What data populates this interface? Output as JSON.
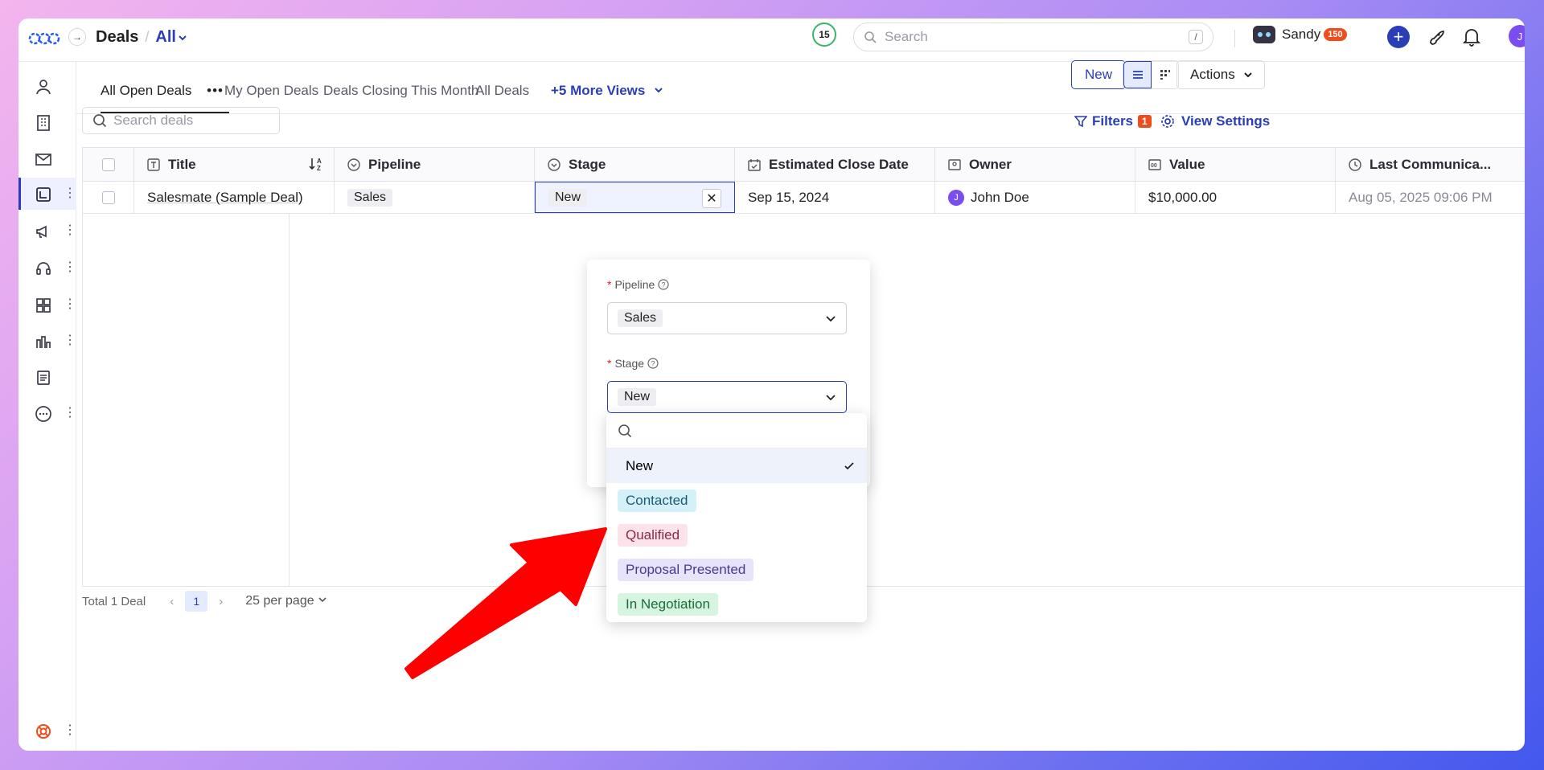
{
  "header": {
    "breadcrumb_current": "Deals",
    "view_name": "All",
    "notification_count": "15",
    "search_placeholder": "Search",
    "search_shortcut": "/",
    "user_name": "Sandy",
    "user_points": "150",
    "avatar_initial": "J"
  },
  "tabs": [
    {
      "label": "All Open Deals"
    },
    {
      "label": "My Open Deals"
    },
    {
      "label": "Deals Closing This Month"
    },
    {
      "label": "All Deals"
    },
    {
      "label": "+5 More Views"
    }
  ],
  "toolbar": {
    "new_label": "New",
    "actions_label": "Actions",
    "search_placeholder": "Search deals",
    "filters_label": "Filters",
    "filters_count": "1",
    "view_settings_label": "View Settings"
  },
  "table": {
    "columns": [
      "Title",
      "Pipeline",
      "Stage",
      "Estimated Close Date",
      "Owner",
      "Value",
      "Last Communica..."
    ],
    "rows": [
      {
        "title": "Salesmate (Sample Deal)",
        "pipeline": "Sales",
        "stage": "New",
        "close_date": "Sep 15, 2024",
        "owner": "John Doe",
        "owner_initial": "J",
        "value": "$10,000.00",
        "last_comm": "Aug 05, 2025 09:06 PM"
      }
    ]
  },
  "footer": {
    "total": "Total 1 Deal",
    "page": "1",
    "per_page": "25 per page"
  },
  "popover": {
    "pipeline_label": "Pipeline",
    "pipeline_value": "Sales",
    "stage_label": "Stage",
    "stage_value": "New",
    "required_mark": "*"
  },
  "stage_options": [
    {
      "label": "New",
      "selected": true,
      "bg": "",
      "color": "#222222"
    },
    {
      "label": "Contacted",
      "selected": false,
      "bg": "#d4f1f9",
      "color": "#1c5a74"
    },
    {
      "label": "Qualified",
      "selected": false,
      "bg": "#fde2ea",
      "color": "#8a2a44"
    },
    {
      "label": "Proposal Presented",
      "selected": false,
      "bg": "#e7e3fb",
      "color": "#4a3a90"
    },
    {
      "label": "In Negotiation",
      "selected": false,
      "bg": "#d6f5e1",
      "color": "#1c6a3a"
    }
  ],
  "colors": {
    "accent": "#2a3fb5",
    "badge": "#ee4d1e",
    "annotation_arrow": "#ff0000"
  }
}
